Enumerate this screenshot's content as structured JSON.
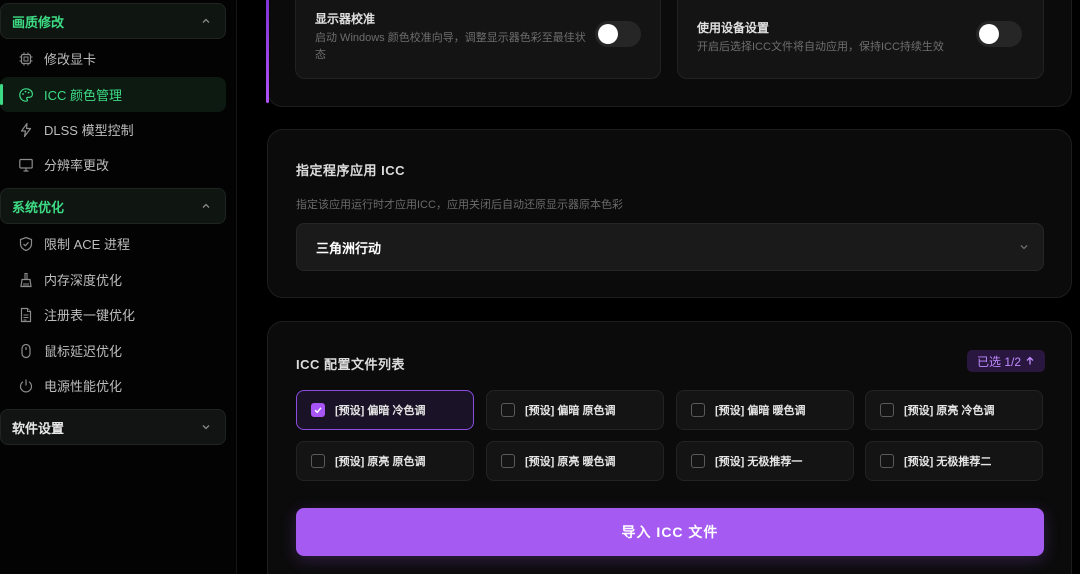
{
  "sidebar": {
    "groups": [
      {
        "label": "画质修改",
        "expanded": true,
        "items": [
          {
            "label": "修改显卡",
            "icon": "chip-icon",
            "selected": false
          },
          {
            "label": "ICC 颜色管理",
            "icon": "palette-icon",
            "selected": true
          },
          {
            "label": "DLSS 模型控制",
            "icon": "lightning-icon",
            "selected": false
          },
          {
            "label": "分辨率更改",
            "icon": "monitor-icon",
            "selected": false
          }
        ]
      },
      {
        "label": "系统优化",
        "expanded": true,
        "items": [
          {
            "label": "限制 ACE 进程",
            "icon": "shield-icon",
            "selected": false
          },
          {
            "label": "内存深度优化",
            "icon": "broom-icon",
            "selected": false
          },
          {
            "label": "注册表一键优化",
            "icon": "document-icon",
            "selected": false
          },
          {
            "label": "鼠标延迟优化",
            "icon": "mouse-icon",
            "selected": false
          },
          {
            "label": "电源性能优化",
            "icon": "power-icon",
            "selected": false
          }
        ]
      },
      {
        "label": "软件设置",
        "expanded": false,
        "items": []
      }
    ]
  },
  "top_card": {
    "calibration": {
      "title": "显示器校准",
      "description": "启动 Windows 颜色校准向导，调整显示器色彩至最佳状态",
      "enabled": false
    },
    "device_settings": {
      "title": "使用设备设置",
      "description": "开启后选择ICC文件将自动应用，保持ICC持续生效",
      "enabled": false
    }
  },
  "app_card": {
    "title": "指定程序应用 ICC",
    "description": "指定该应用运行时才应用ICC，应用关闭后自动还原显示器原本色彩",
    "selected_app": "三角洲行动"
  },
  "icc_card": {
    "title": "ICC 配置文件列表",
    "badge": "已选 1/2",
    "profiles": [
      {
        "label": "[预设] 偏暗 冷色调",
        "checked": true
      },
      {
        "label": "[预设] 偏暗 原色调",
        "checked": false
      },
      {
        "label": "[预设] 偏暗 暖色调",
        "checked": false
      },
      {
        "label": "[预设] 原亮 冷色调",
        "checked": false
      },
      {
        "label": "[预设] 原亮 原色调",
        "checked": false
      },
      {
        "label": "[预设] 原亮 暖色调",
        "checked": false
      },
      {
        "label": "[预设] 无极推荐一",
        "checked": false
      },
      {
        "label": "[预设] 无极推荐二",
        "checked": false
      }
    ],
    "import_label": "导入 ICC 文件"
  },
  "colors": {
    "accent_green": "#3ddc84",
    "accent_purple": "#a855f7",
    "background": "#000000"
  }
}
